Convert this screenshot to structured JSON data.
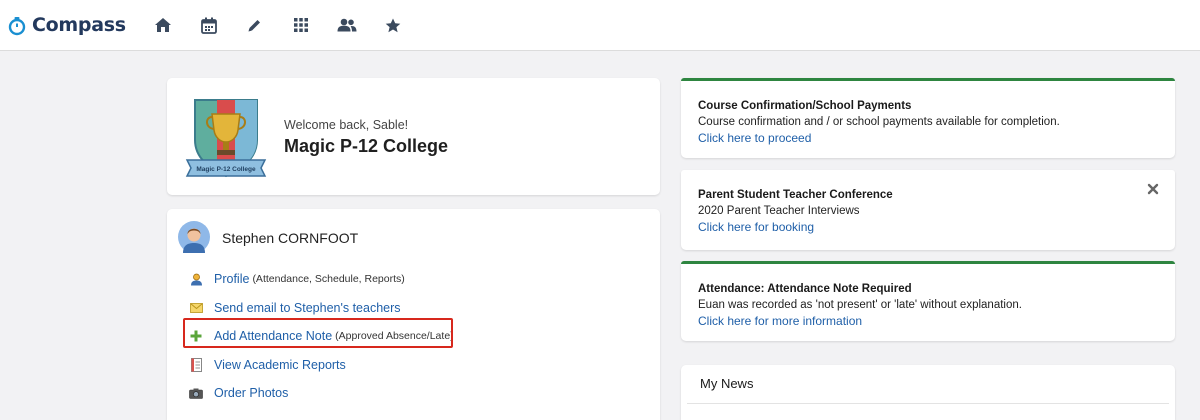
{
  "brand": {
    "name": "Compass",
    "accent": "#1a8fd1",
    "logo_icon": "stopwatch-icon"
  },
  "nav": {
    "icons": [
      "home-icon",
      "calendar-icon",
      "pencil-icon",
      "grid-icon",
      "people-icon",
      "star-icon"
    ],
    "icon_color": "#3b4a5e"
  },
  "school": {
    "welcome": "Welcome back, Sable!",
    "name": "Magic P-12 College",
    "crest_banner": "Magic P-12 College"
  },
  "student": {
    "name": "Stephen CORNFOOT",
    "links": [
      {
        "label": "Profile",
        "sub": "(Attendance, Schedule, Reports)",
        "icon": "profile-icon"
      },
      {
        "label": "Send email to Stephen's teachers",
        "sub": "",
        "icon": "envelope-icon"
      },
      {
        "label": "Add Attendance Note",
        "sub": "(Approved Absence/Late)",
        "icon": "plus-icon"
      },
      {
        "label": "View Academic Reports",
        "sub": "",
        "icon": "report-icon"
      },
      {
        "label": "Order Photos",
        "sub": "",
        "icon": "camera-icon"
      }
    ]
  },
  "notices": [
    {
      "title": "Course Confirmation/School Payments",
      "body": "Course confirmation and / or school payments available for completion.",
      "link": "Click here to proceed",
      "closable": false
    },
    {
      "title": "Parent Student Teacher Conference",
      "body": "2020 Parent Teacher Interviews",
      "link": "Click here for booking",
      "closable": true
    },
    {
      "title": "Attendance: Attendance Note Required",
      "body": "Euan was recorded as 'not present' or 'late' without explanation.",
      "link": "Click here for more information",
      "closable": false
    }
  ],
  "news": {
    "title": "My News"
  },
  "colors": {
    "link": "#1f5fa8",
    "notice_accent": "#2e8540",
    "highlight": "#d7281d"
  }
}
